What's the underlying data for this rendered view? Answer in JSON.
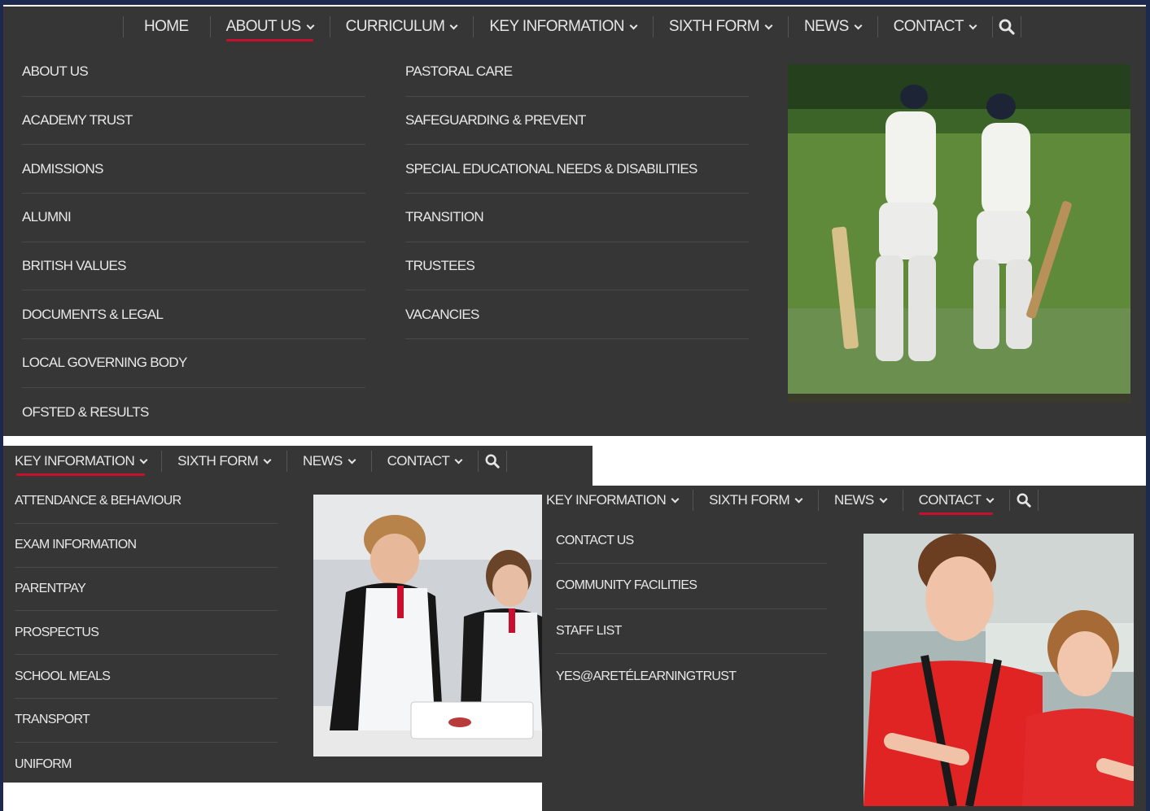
{
  "colors": {
    "panel": "#363636",
    "accent_underline": "#c8102e",
    "text": "#e8e8e8",
    "edge": "#1b2a4e"
  },
  "menu1": {
    "nav": [
      {
        "label": "HOME",
        "has_dropdown": false
      },
      {
        "label": "ABOUT US",
        "has_dropdown": true,
        "active": true
      },
      {
        "label": "CURRICULUM",
        "has_dropdown": true
      },
      {
        "label": "KEY INFORMATION",
        "has_dropdown": true
      },
      {
        "label": "SIXTH FORM",
        "has_dropdown": true
      },
      {
        "label": "NEWS",
        "has_dropdown": true
      },
      {
        "label": "CONTACT",
        "has_dropdown": true
      }
    ],
    "search_icon": "search-icon",
    "col1": [
      "ABOUT US",
      "ACADEMY TRUST",
      "ADMISSIONS",
      "ALUMNI",
      "BRITISH VALUES",
      "DOCUMENTS & LEGAL",
      "LOCAL GOVERNING BODY",
      "OFSTED & RESULTS"
    ],
    "col2": [
      "PASTORAL CARE",
      "SAFEGUARDING & PREVENT",
      "SPECIAL EDUCATIONAL NEEDS & DISABILITIES",
      "TRANSITION",
      "TRUSTEES",
      "VACANCIES"
    ],
    "photo": "cricket-players-photo"
  },
  "menu2": {
    "nav": [
      {
        "label": "KEY INFORMATION",
        "has_dropdown": true,
        "active": true
      },
      {
        "label": "SIXTH FORM",
        "has_dropdown": true
      },
      {
        "label": "NEWS",
        "has_dropdown": true
      },
      {
        "label": "CONTACT",
        "has_dropdown": true
      }
    ],
    "search_icon": "search-icon",
    "items": [
      "ATTENDANCE & BEHAVIOUR",
      "EXAM INFORMATION",
      "PARENTPAY",
      "PROSPECTUS",
      "SCHOOL MEALS",
      "TRANSPORT",
      "UNIFORM"
    ],
    "photo": "science-class-photo"
  },
  "menu3": {
    "nav": [
      {
        "label": "KEY INFORMATION",
        "has_dropdown": true
      },
      {
        "label": "SIXTH FORM",
        "has_dropdown": true
      },
      {
        "label": "NEWS",
        "has_dropdown": true
      },
      {
        "label": "CONTACT",
        "has_dropdown": true,
        "active": true
      }
    ],
    "search_icon": "search-icon",
    "items": [
      "CONTACT US",
      "COMMUNITY FACILITIES",
      "STAFF LIST",
      "YES@ARETÉLEARNINGTRUST"
    ],
    "photo": "students-teamwork-photo"
  }
}
